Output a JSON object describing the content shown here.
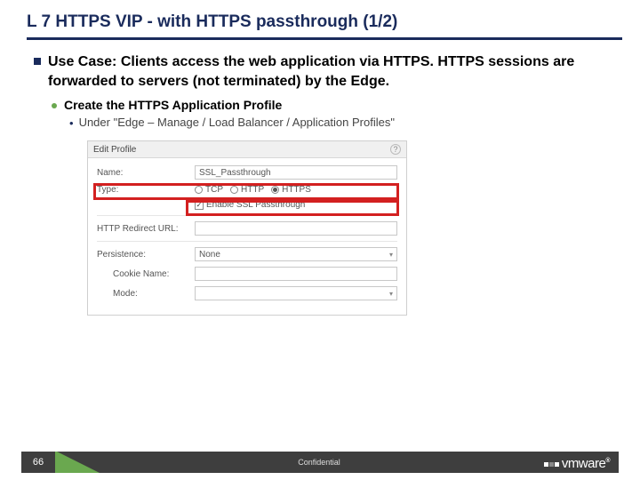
{
  "title": "L 7 HTTPS VIP - with HTTPS passthrough (1/2)",
  "bullet_main": "Use Case: Clients access the web application via HTTPS. HTTPS sessions are forwarded to servers (not terminated) by the Edge.",
  "sub1": "Create the HTTPS Application Profile",
  "sub2": "Under \"Edge – Manage /  Load Balancer / Application Profiles\"",
  "dialog": {
    "header": "Edit Profile",
    "help": "?",
    "rows": {
      "name_label": "Name:",
      "name_value": "SSL_Passthrough",
      "type_label": "Type:",
      "type_options": {
        "tcp": "TCP",
        "http": "HTTP",
        "https": "HTTPS"
      },
      "ssl_passthrough": "Enable SSL Passthrough",
      "redirect_label": "HTTP Redirect URL:",
      "persistence_label": "Persistence:",
      "persistence_value": "None",
      "cookie_label": "Cookie Name:",
      "mode_label": "Mode:"
    }
  },
  "footer": {
    "page": "66",
    "confidential": "Confidential",
    "brand": "vmware",
    "reg": "®"
  }
}
